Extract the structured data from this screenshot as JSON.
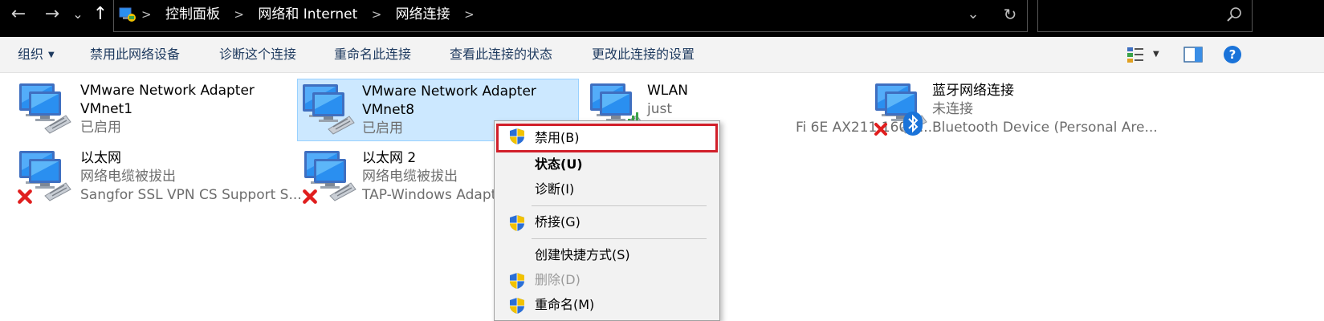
{
  "address_bar": {
    "nav": {
      "back": "←",
      "forward": "→",
      "recent": "⌄",
      "up": "↑"
    },
    "breadcrumbs": [
      "控制面板",
      "网络和 Internet",
      "网络连接"
    ],
    "dropdown": "⌄",
    "refresh": "↻"
  },
  "command_bar": {
    "organize": "组织",
    "disable_device": "禁用此网络设备",
    "diagnose": "诊断这个连接",
    "rename": "重命名此连接",
    "view_status": "查看此连接的状态",
    "change_settings": "更改此连接的设置",
    "help": "?"
  },
  "connections": [
    {
      "name": "VMware Network Adapter",
      "name2": "VMnet1",
      "status": "已启用",
      "icon": "network-adapter-icon"
    },
    {
      "name": "VMware Network Adapter",
      "name2": "VMnet8",
      "status": "已启用",
      "icon": "network-adapter-icon",
      "selected": true
    },
    {
      "name": "WLAN",
      "status": "just",
      "device": "Fi 6E AX211 160M...",
      "icon": "wifi-adapter-icon"
    },
    {
      "name": "蓝牙网络连接",
      "status": "未连接",
      "device": "Bluetooth Device (Personal Are...",
      "icon": "bluetooth-adapter-icon"
    },
    {
      "name": "以太网",
      "status": "网络电缆被拔出",
      "device": "Sangfor SSL VPN CS Support S...",
      "icon": "ethernet-adapter-icon"
    },
    {
      "name": "以太网 2",
      "status": "网络电缆被拔出",
      "device": "TAP-Windows Adapt",
      "icon": "ethernet-adapter-icon"
    }
  ],
  "context_menu": {
    "disable": "禁用(B)",
    "status": "状态(U)",
    "diagnose": "诊断(I)",
    "bridge": "桥接(G)",
    "shortcut": "创建快捷方式(S)",
    "delete": "删除(D)",
    "rename": "重命名(M)"
  },
  "colors": {
    "accent_selection": "#cce8ff",
    "highlight_border": "#d11f2a",
    "shield_blue": "#2b6fd6",
    "shield_yellow": "#f2c200",
    "error_red": "#e01e1e",
    "bluetooth_blue": "#1a73d9",
    "wifi_green": "#3aa34a"
  }
}
